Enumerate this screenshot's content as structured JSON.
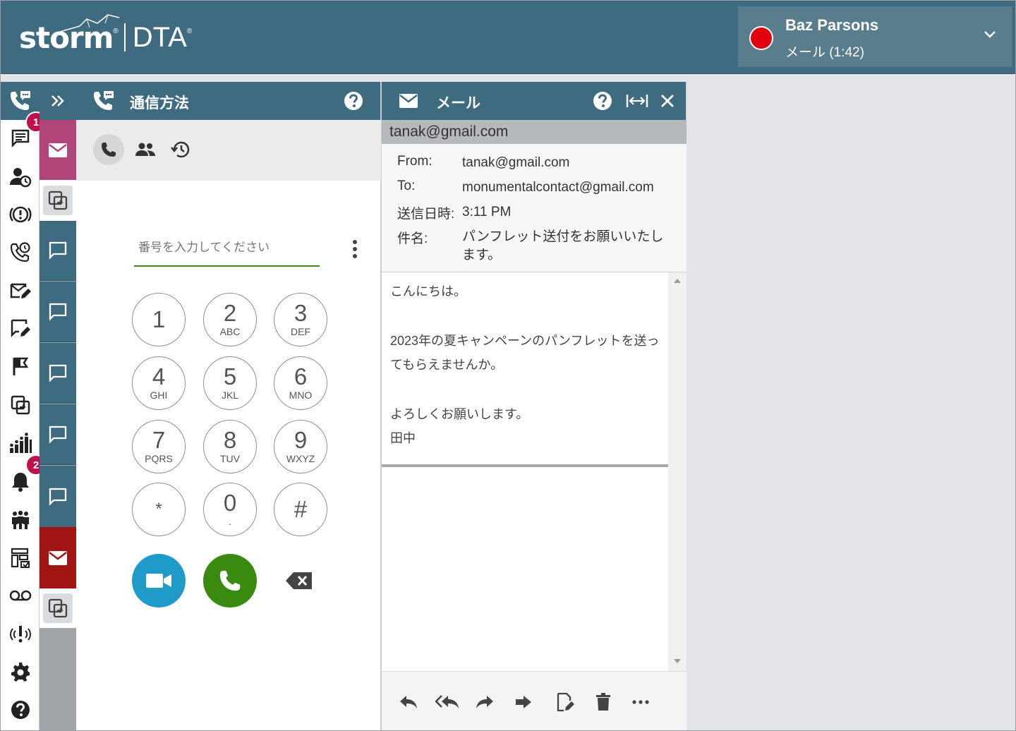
{
  "header": {
    "logo_main": "storm",
    "logo_reg": "®",
    "logo_sub": "DTA",
    "logo_sub_reg": "®",
    "user_name": "Baz Parsons",
    "user_status": "メール  (1:42)",
    "status_color": "#e0000f"
  },
  "leftnav": {
    "badges": {
      "messages": "1",
      "notifications": "2"
    },
    "items": [
      "phone-chat-icon",
      "message-icon",
      "user-clock-icon",
      "alert-circle-icon",
      "phone-history-icon",
      "email-edit-icon",
      "chat-edit-icon",
      "flag-icon",
      "copy-icon",
      "stats-people-icon",
      "bell-icon",
      "team-icon",
      "layout-icon",
      "voicemail-icon",
      "broadcast-icon",
      "gear-icon",
      "help-icon"
    ]
  },
  "dialer": {
    "title": "通信方法",
    "placeholder": "番号を入力してください",
    "keys": [
      {
        "digit": "1",
        "letters": ""
      },
      {
        "digit": "2",
        "letters": "ABC"
      },
      {
        "digit": "3",
        "letters": "DEF"
      },
      {
        "digit": "4",
        "letters": "GHI"
      },
      {
        "digit": "5",
        "letters": "JKL"
      },
      {
        "digit": "6",
        "letters": "MNO"
      },
      {
        "digit": "7",
        "letters": "PQRS"
      },
      {
        "digit": "8",
        "letters": "TUV"
      },
      {
        "digit": "9",
        "letters": "WXYZ"
      },
      {
        "digit": "*",
        "letters": ""
      },
      {
        "digit": "0",
        "letters": "."
      },
      {
        "digit": "#",
        "letters": ""
      }
    ],
    "video_color": "#1e9bc9",
    "call_color": "#3b8a10"
  },
  "email": {
    "title": "メール",
    "address_bar": "tanak@gmail.com",
    "from_label": "From:",
    "from_value": "tanak@gmail.com",
    "to_label": "To:",
    "to_value": "monumentalcontact@gmail.com",
    "sent_label": "送信日時:",
    "sent_value": "3:11 PM",
    "subject_label": "件名:",
    "subject_value": "パンフレット送付をお願いいたします。",
    "body": [
      "こんにちは。",
      "",
      "2023年の夏キャンペーンのパンフレットを送ってもらえませんか。",
      "",
      "よろしくお願いします。",
      "田中"
    ]
  },
  "colors": {
    "header_bg": "#3f6b80",
    "email_tile": "#b0457a",
    "email_tile_alert": "#a01414",
    "chat_tile": "#3f6b80"
  }
}
